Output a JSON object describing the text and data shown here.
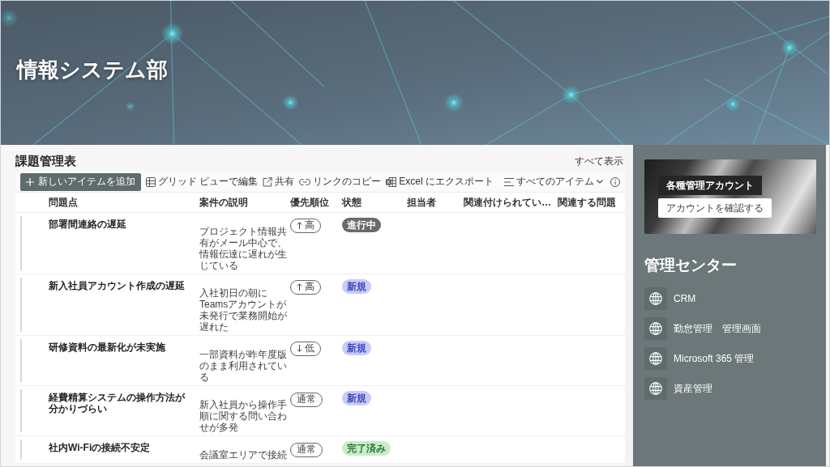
{
  "banner": {
    "title": "情報システム部"
  },
  "issues_list": {
    "title": "課題管理表",
    "see_all": "すべて表示",
    "toolbar": {
      "new_item": "新しいアイテムを追加",
      "actions": [
        {
          "kind": "grid",
          "label": "グリッド ビューで編集"
        },
        {
          "kind": "share",
          "label": "共有"
        },
        {
          "kind": "link",
          "label": "リンクのコピー"
        },
        {
          "kind": "excel",
          "label": "Excel にエクスポート"
        }
      ],
      "view": "すべてのアイテム"
    },
    "columns": [
      "問題点",
      "案件の説明",
      "優先順位",
      "状態",
      "担当者",
      "関連付けられてい…",
      "関連する問題"
    ],
    "rows": [
      {
        "issue": "部署間連絡の遅延",
        "description": "プロジェクト情報共有がメール中心で、情報伝達に遅れが生じている",
        "priority": {
          "kind": "up",
          "label": "高"
        },
        "status": {
          "kind": "in_progress",
          "label": "進行中",
          "color": "#6b6b6b"
        }
      },
      {
        "issue": "新入社員アカウント作成の遅延",
        "description": "入社初日の朝にTeamsアカウントが未発行で業務開始が遅れた",
        "priority": {
          "kind": "up",
          "label": "高"
        },
        "status": {
          "kind": "new",
          "label": "新規",
          "color": "#c8cbf7"
        }
      },
      {
        "issue": "研修資料の最新化が未実施",
        "description": "一部資料が昨年度版のまま利用されている",
        "priority": {
          "kind": "down",
          "label": "低"
        },
        "status": {
          "kind": "new",
          "label": "新規",
          "color": "#c8cbf7"
        }
      },
      {
        "issue": "経費精算システムの操作方法が分かりづらい",
        "description": "新入社員から操作手順に関する問い合わせが多発",
        "priority": {
          "kind": "none",
          "label": "通常"
        },
        "status": {
          "kind": "new",
          "label": "新規",
          "color": "#c8cbf7"
        }
      },
      {
        "issue": "社内Wi-Fiの接続不安定",
        "description": "会議室エリアで接続",
        "priority": {
          "kind": "none",
          "label": "通常"
        },
        "status": {
          "kind": "done",
          "label": "完了済み",
          "color": "#c5eec8"
        }
      }
    ]
  },
  "sidebar": {
    "promo": {
      "title": "各種管理アカウント",
      "button": "アカウントを確認する"
    },
    "heading": "管理センター",
    "links": [
      "CRM",
      "勤怠管理　管理画面",
      "Microsoft 365 管理",
      "資産管理"
    ]
  }
}
